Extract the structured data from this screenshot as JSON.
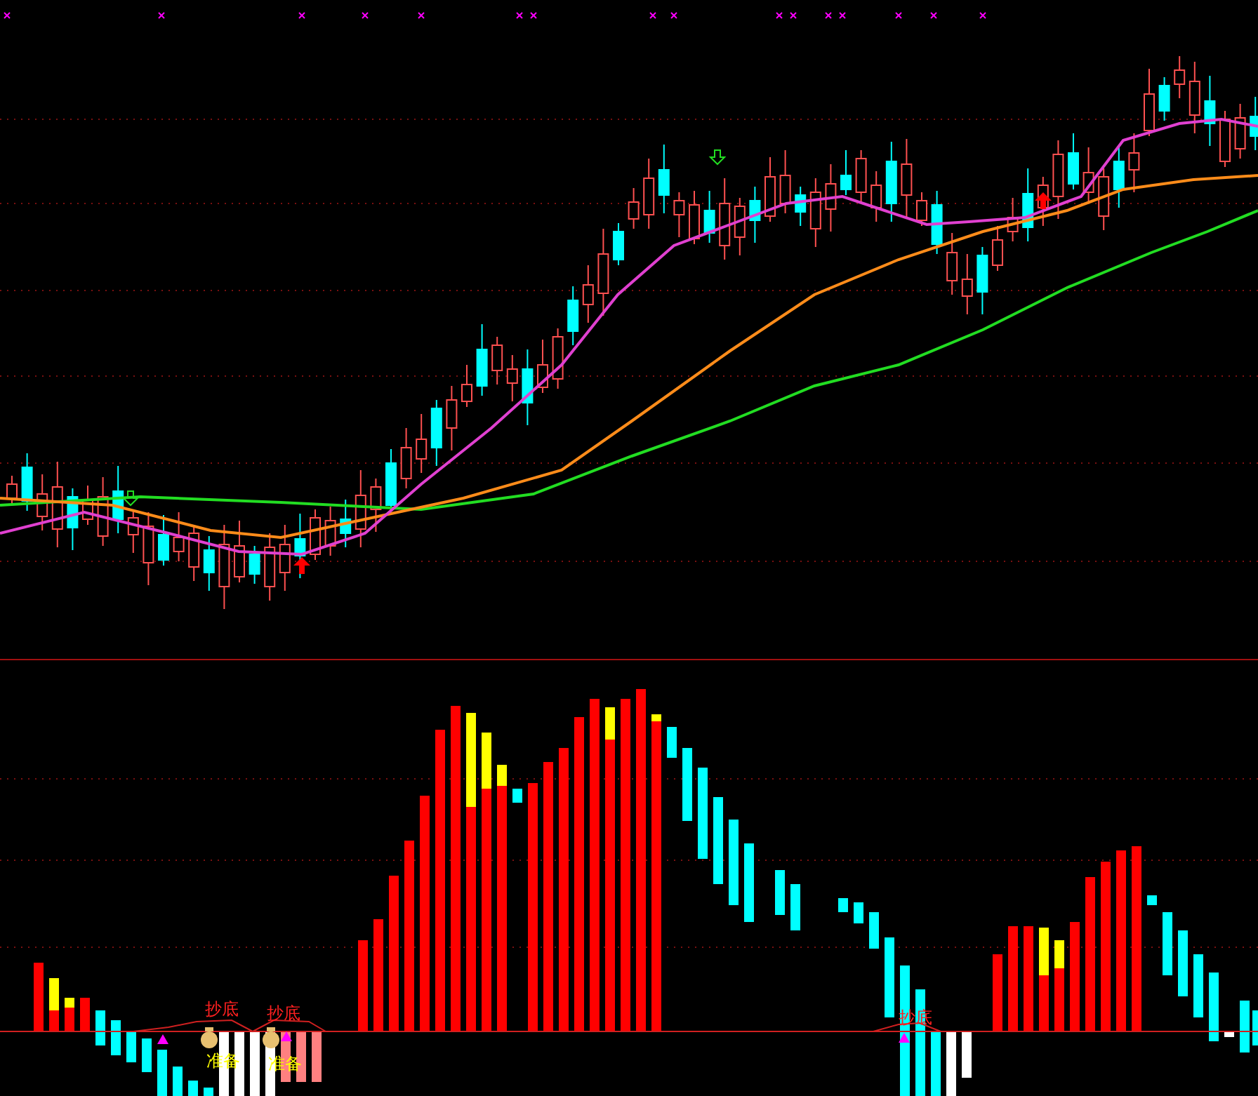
{
  "indicator_panel": {
    "signals": [
      {
        "label": "抄底",
        "prep": "准备"
      },
      {
        "label": "抄底",
        "prep": "准备"
      },
      {
        "label": "抄底"
      }
    ]
  }
}
